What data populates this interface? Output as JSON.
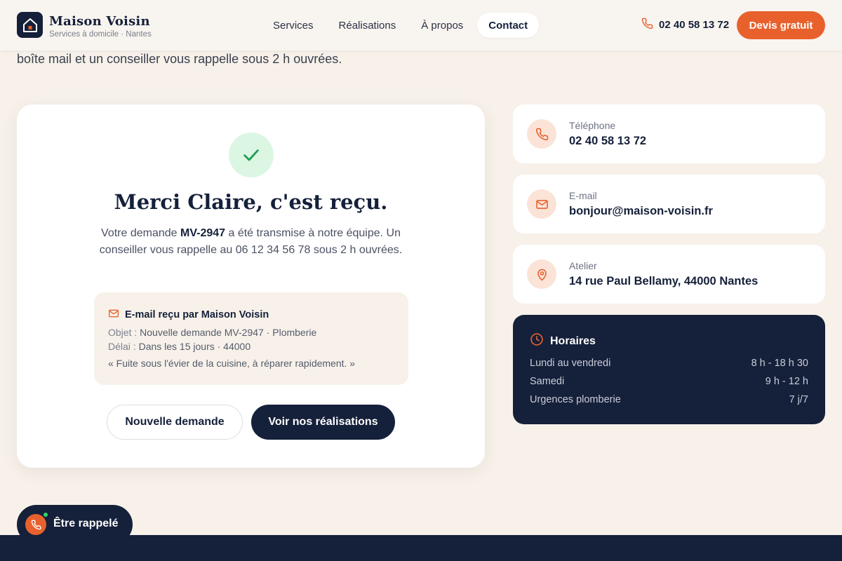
{
  "brand": {
    "name": "Maison Voisin",
    "subtitle": "Services à domicile · Nantes"
  },
  "nav": {
    "items": [
      {
        "label": "Services"
      },
      {
        "label": "Réalisations"
      },
      {
        "label": "À propos"
      },
      {
        "label": "Contact",
        "active": true
      }
    ]
  },
  "header": {
    "phone": "02 40 58 13 72",
    "cta": "Devis gratuit"
  },
  "intro_text": "boîte mail et un conseiller vous rappelle sous 2 h ouvrées.",
  "confirmation": {
    "title": "Merci Claire, c'est reçu.",
    "msg_before": "Votre demande ",
    "request_id": "MV-2947",
    "msg_after": " a été transmise à notre équipe. Un conseiller vous rappelle au 06 12 34 56 78 sous 2 h ouvrées.",
    "email": {
      "heading": "E-mail reçu par Maison Voisin",
      "subject_label": "Objet :",
      "subject_value": "Nouvelle demande MV-2947 · Plomberie",
      "delay_label": "Délai :",
      "delay_value": "Dans les 15 jours · 44000",
      "quote": "« Fuite sous l'évier de la cuisine, à réparer rapidement. »"
    },
    "btn_new": "Nouvelle demande",
    "btn_works": "Voir nos réalisations"
  },
  "contact": [
    {
      "label": "Téléphone",
      "value": "02 40 58 13 72",
      "icon": "phone-icon"
    },
    {
      "label": "E-mail",
      "value": "bonjour@maison-voisin.fr",
      "icon": "mail-icon"
    },
    {
      "label": "Atelier",
      "value": "14 rue Paul Bellamy, 44000 Nantes",
      "icon": "map-pin-icon"
    }
  ],
  "hours": {
    "title": "Horaires",
    "rows": [
      {
        "day": "Lundi au vendredi",
        "time": "8 h - 18 h 30"
      },
      {
        "day": "Samedi",
        "time": "9 h - 12 h"
      },
      {
        "day": "Urgences plomberie",
        "time": "7 j/7"
      }
    ]
  },
  "callback": {
    "label": "Être rappelé"
  },
  "colors": {
    "accent": "#e8612c",
    "navy": "#15203a",
    "background": "#f7f1ea",
    "success": "#1f9d55"
  }
}
